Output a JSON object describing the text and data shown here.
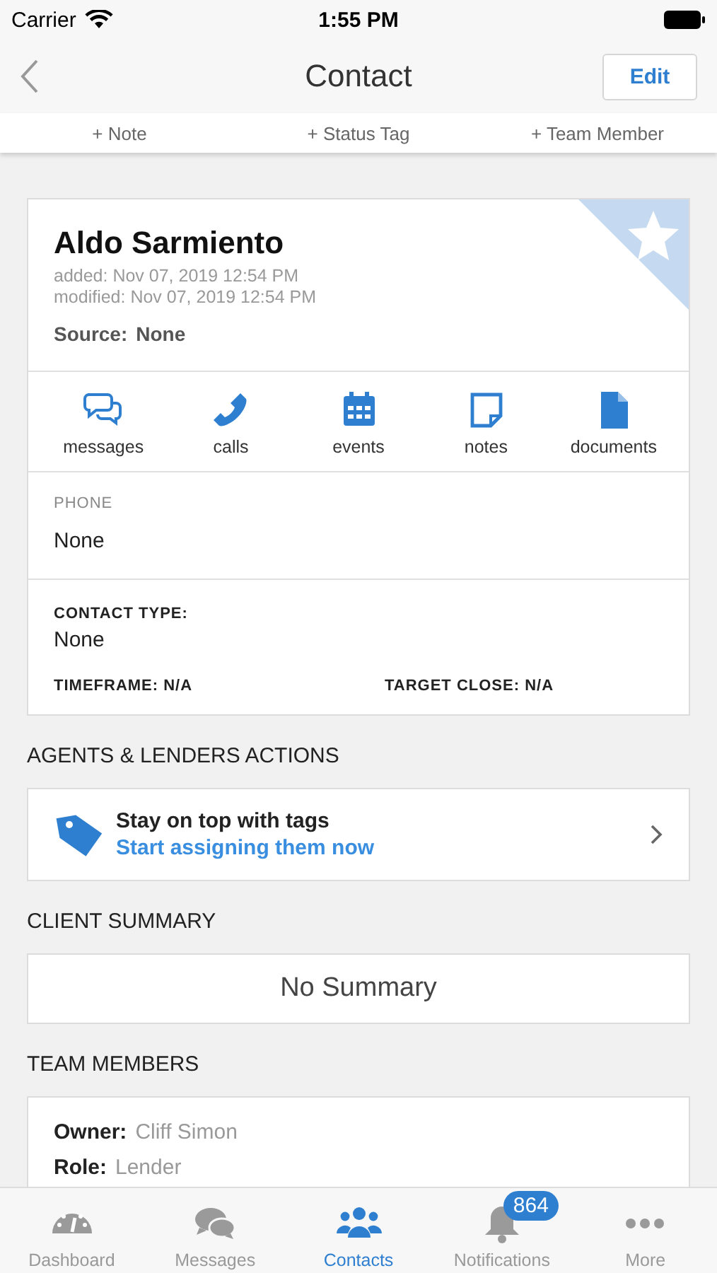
{
  "status_bar": {
    "carrier": "Carrier",
    "time": "1:55 PM"
  },
  "nav": {
    "title": "Contact",
    "edit": "Edit"
  },
  "quick_actions": [
    "+ Note",
    "+ Status Tag",
    "+ Team Member"
  ],
  "contact": {
    "name": "Aldo Sarmiento",
    "added": "added: Nov 07, 2019 12:54 PM",
    "modified": "modified: Nov 07, 2019 12:54 PM",
    "source_label": "Source:",
    "source": "None",
    "favorite": false
  },
  "actions": [
    {
      "kind": "messages",
      "label": "messages"
    },
    {
      "kind": "calls",
      "label": "calls"
    },
    {
      "kind": "events",
      "label": "events"
    },
    {
      "kind": "notes",
      "label": "notes"
    },
    {
      "kind": "documents",
      "label": "documents"
    }
  ],
  "phone": {
    "label": "PHONE",
    "value": "None"
  },
  "details": {
    "contact_type_label": "CONTACT TYPE:",
    "contact_type": "None",
    "timeframe": "TIMEFRAME: N/A",
    "target_close": "TARGET CLOSE: N/A"
  },
  "agents_heading": "AGENTS & LENDERS ACTIONS",
  "tags_promo": {
    "title": "Stay on top with tags",
    "link": "Start assigning them now"
  },
  "summary_heading": "CLIENT SUMMARY",
  "summary": "No Summary",
  "team_heading": "TEAM MEMBERS",
  "team": [
    {
      "label": "Owner:",
      "value": "Cliff Simon"
    },
    {
      "label": "Role:",
      "value": "Lender"
    }
  ],
  "tab_bar": [
    {
      "kind": "dashboard",
      "label": "Dashboard",
      "selected": false
    },
    {
      "kind": "messages",
      "label": "Messages",
      "selected": false
    },
    {
      "kind": "contacts",
      "label": "Contacts",
      "selected": true
    },
    {
      "kind": "notifications",
      "label": "Notifications",
      "selected": false,
      "badge": "864"
    },
    {
      "kind": "more",
      "label": "More",
      "selected": false
    }
  ]
}
